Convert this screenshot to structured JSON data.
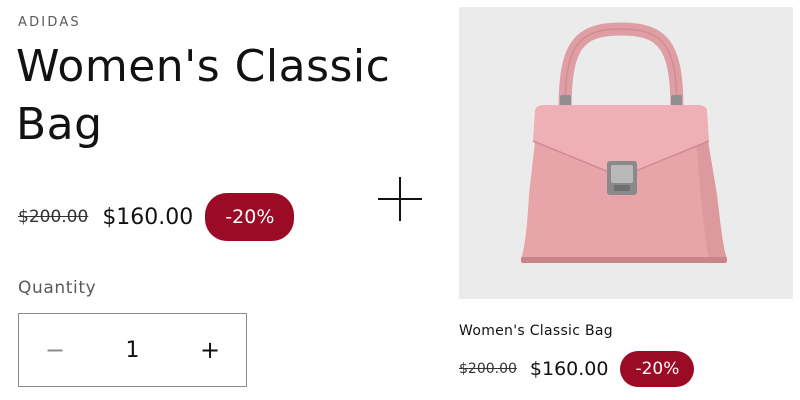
{
  "product": {
    "vendor": "ADIDAS",
    "title": "Women's Classic Bag",
    "compare_price": "$200.00",
    "sale_price": "$160.00",
    "discount_badge": "-20%"
  },
  "quantity": {
    "label": "Quantity",
    "value": "1",
    "decrease_symbol": "−",
    "increase_symbol": "+"
  },
  "bundle_item": {
    "image_icon": "handbag-image",
    "title": "Women's Classic Bag",
    "compare_price": "$200.00",
    "sale_price": "$160.00",
    "discount_badge": "-20%"
  },
  "colors": {
    "badge": "#9b0b26",
    "image_background": "#ebebeb",
    "bag": "#e8a5a9"
  }
}
